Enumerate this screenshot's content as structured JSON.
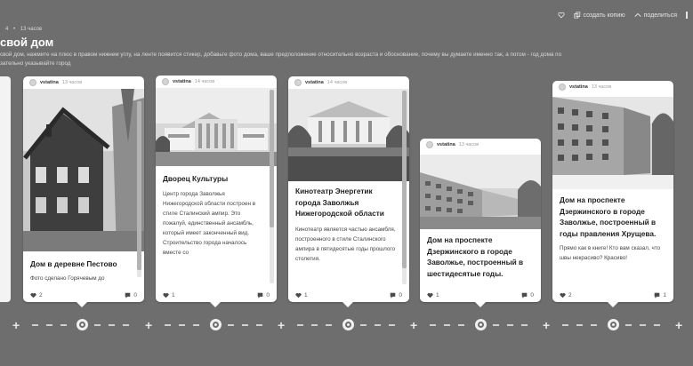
{
  "header": {
    "breadcrumb": [
      "4",
      "•",
      "13 часов"
    ],
    "title": "свой дом",
    "description": "свой дом, нажмите на плюс в правом нижнем углу, на ленте появится стикер, добавьте фото дома, ваше предположение относительно возраста и обоснование, почему вы думаете именно так, а потом - год дома по\nзательно указывайте город",
    "actions": [
      {
        "icon": "heart-icon",
        "label": ""
      },
      {
        "icon": "copy-icon",
        "label": "создать копию"
      },
      {
        "icon": "share-icon",
        "label": "поделиться"
      }
    ]
  },
  "cards": [
    {
      "author": "vstatina",
      "time": "13 часов",
      "title": "Дом в деревне Пестово",
      "text": "Фото сделано Горячевым до",
      "likes": "2",
      "comments": "0",
      "photo": "wooden-house"
    },
    {
      "author": "vstatina",
      "time": "14 часов",
      "title": "Дворец Культуры",
      "text": "Центр города Заволжья Нижегородской области построен в стиле Сталинский ампир. Это пожалуй, единственный ансамбль, который имеет законченный вид. Строительство города началось вместе со",
      "likes": "1",
      "comments": "0",
      "photo": "palace-of-culture"
    },
    {
      "author": "vstatina",
      "time": "14 часов",
      "title": "Кинотеатр Энергетик города Заволжья Нижегородской области",
      "text": "Кинотеатр  является частью ансамбля, построенного в стиле Сталинского ампира в пятидесятые годы прошлого столетия.",
      "likes": "1",
      "comments": "0",
      "photo": "cinema"
    },
    {
      "author": "vstatina",
      "time": "13 часов",
      "title": "Дом на проспекте Дзержинского в городе Заволжье, построенный в шестидесятые годы.",
      "text": "",
      "likes": "1",
      "comments": "0",
      "photo": "apartment-block"
    },
    {
      "author": "vstatina",
      "time": "13 часов",
      "title": "Дом на проспекте Дзержинского в городе Заволжье, построенный в годы правления Хрущева.",
      "text": "Прямо как в книге! Кто вам сказал, что швы некрасиво? Красиво!",
      "likes": "2",
      "comments": "1",
      "photo": "khrushchev-block"
    }
  ],
  "colors": {
    "background": "#6e6e6e",
    "card": "#ffffff",
    "timeline": "#f0f0f0"
  }
}
